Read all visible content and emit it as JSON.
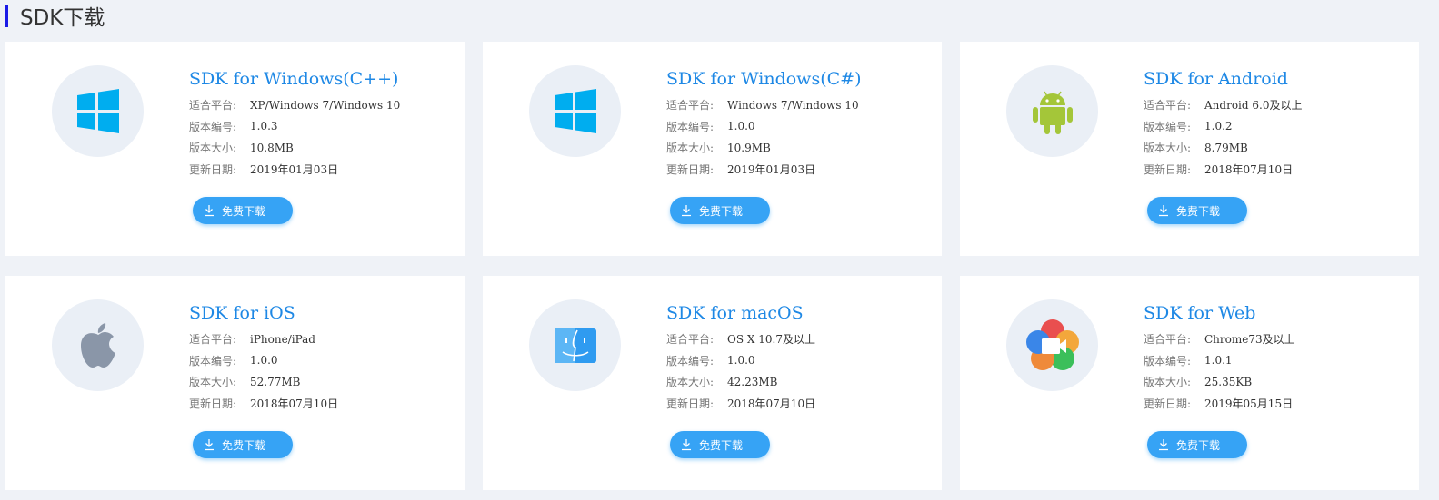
{
  "section": {
    "title": "SDK下载"
  },
  "cards": [
    {
      "title": "SDK for Windows(C++)",
      "icon": "windows-icon",
      "platform_label": "适合平台:",
      "platform": "XP/Windows 7/Windows 10",
      "version_label": "版本编号:",
      "version": "1.0.3",
      "size_label": "版本大小:",
      "size": "10.8MB",
      "date_label": "更新日期:",
      "date": "2019年01月03日",
      "button": "免费下载"
    },
    {
      "title": "SDK for Windows(C#)",
      "icon": "windows-icon",
      "platform_label": "适合平台:",
      "platform": "Windows 7/Windows 10",
      "version_label": "版本编号:",
      "version": "1.0.0",
      "size_label": "版本大小:",
      "size": "10.9MB",
      "date_label": "更新日期:",
      "date": "2019年01月03日",
      "button": "免费下载"
    },
    {
      "title": "SDK for Android",
      "icon": "android-icon",
      "platform_label": "适合平台:",
      "platform": "Android 6.0及以上",
      "version_label": "版本编号:",
      "version": "1.0.2",
      "size_label": "版本大小:",
      "size": "8.79MB",
      "date_label": "更新日期:",
      "date": "2018年07月10日",
      "button": "免费下载"
    },
    {
      "title": "SDK for iOS",
      "icon": "apple-icon",
      "platform_label": "适合平台:",
      "platform": "iPhone/iPad",
      "version_label": "版本编号:",
      "version": "1.0.0",
      "size_label": "版本大小:",
      "size": "52.77MB",
      "date_label": "更新日期:",
      "date": "2018年07月10日",
      "button": "免费下载"
    },
    {
      "title": "SDK for macOS",
      "icon": "finder-icon",
      "platform_label": "适合平台:",
      "platform": "OS X 10.7及以上",
      "version_label": "版本编号:",
      "version": "1.0.0",
      "size_label": "版本大小:",
      "size": "42.23MB",
      "date_label": "更新日期:",
      "date": "2018年07月10日",
      "button": "免费下载"
    },
    {
      "title": "SDK for Web",
      "icon": "webrtc-icon",
      "platform_label": "适合平台:",
      "platform": "Chrome73及以上",
      "version_label": "版本编号:",
      "version": "1.0.1",
      "size_label": "版本大小:",
      "size": "25.35KB",
      "date_label": "更新日期:",
      "date": "2019年05月15日",
      "button": "免费下载"
    }
  ],
  "colors": {
    "accent": "#1e88e5",
    "button": "#36a3f5",
    "title_bar": "#1a1ae6",
    "background": "#eff2f7",
    "icon_bg": "#eaeff6"
  }
}
